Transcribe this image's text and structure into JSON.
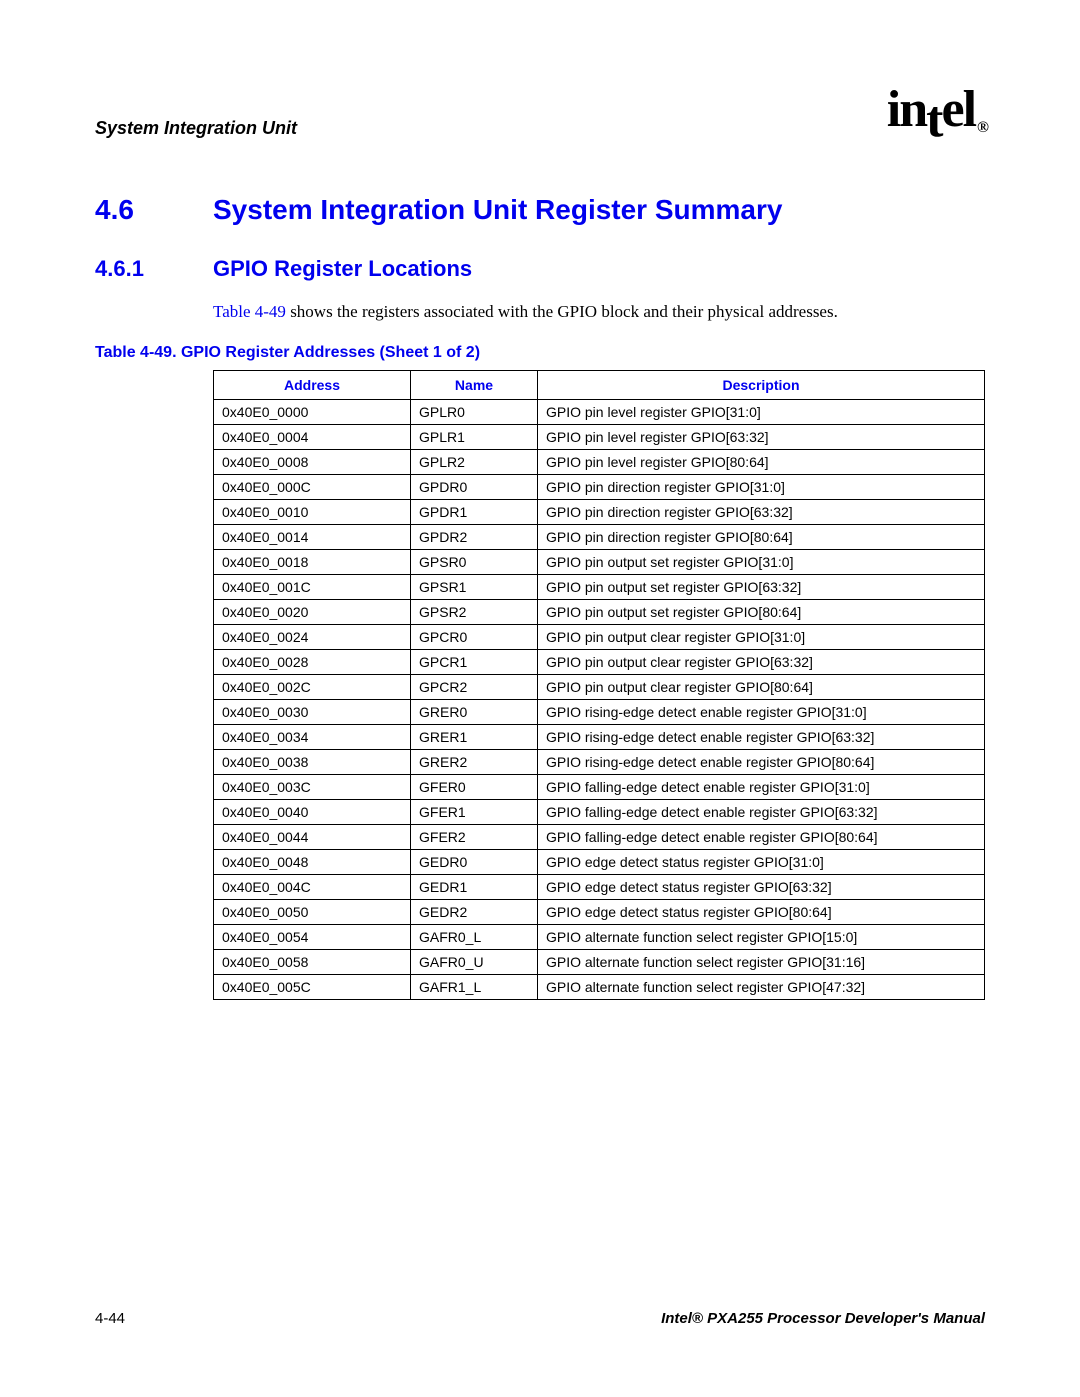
{
  "header": {
    "chapter_title": "System Integration Unit",
    "logo_text": "intel",
    "logo_reg": "®"
  },
  "section": {
    "num": "4.6",
    "title": "System Integration Unit Register Summary"
  },
  "subsection": {
    "num": "4.6.1",
    "title": "GPIO Register Locations"
  },
  "body": {
    "link_text": "Table 4-49",
    "rest_text": " shows the registers associated with the GPIO block and their physical addresses."
  },
  "table": {
    "caption": "Table 4-49. GPIO Register Addresses (Sheet 1 of 2)",
    "headers": {
      "address": "Address",
      "name": "Name",
      "description": "Description"
    },
    "rows": [
      {
        "address": "0x40E0_0000",
        "name": "GPLR0",
        "description": "GPIO pin level register GPIO[31:0]"
      },
      {
        "address": "0x40E0_0004",
        "name": "GPLR1",
        "description": "GPIO pin level register GPIO[63:32]"
      },
      {
        "address": "0x40E0_0008",
        "name": "GPLR2",
        "description": "GPIO pin level register GPIO[80:64]"
      },
      {
        "address": "0x40E0_000C",
        "name": "GPDR0",
        "description": "GPIO pin direction register GPIO[31:0]"
      },
      {
        "address": "0x40E0_0010",
        "name": "GPDR1",
        "description": "GPIO pin direction register GPIO[63:32]"
      },
      {
        "address": "0x40E0_0014",
        "name": "GPDR2",
        "description": "GPIO pin direction register GPIO[80:64]"
      },
      {
        "address": "0x40E0_0018",
        "name": "GPSR0",
        "description": "GPIO pin output set register GPIO[31:0]"
      },
      {
        "address": "0x40E0_001C",
        "name": "GPSR1",
        "description": "GPIO pin output set register GPIO[63:32]"
      },
      {
        "address": "0x40E0_0020",
        "name": "GPSR2",
        "description": "GPIO pin output set register GPIO[80:64]"
      },
      {
        "address": "0x40E0_0024",
        "name": "GPCR0",
        "description": "GPIO pin output clear register GPIO[31:0]"
      },
      {
        "address": "0x40E0_0028",
        "name": "GPCR1",
        "description": "GPIO pin output clear register GPIO[63:32]"
      },
      {
        "address": "0x40E0_002C",
        "name": "GPCR2",
        "description": "GPIO pin output clear register GPIO[80:64]"
      },
      {
        "address": "0x40E0_0030",
        "name": "GRER0",
        "description": "GPIO rising-edge detect enable register GPIO[31:0]"
      },
      {
        "address": "0x40E0_0034",
        "name": "GRER1",
        "description": "GPIO rising-edge detect enable register GPIO[63:32]"
      },
      {
        "address": "0x40E0_0038",
        "name": "GRER2",
        "description": "GPIO rising-edge detect enable register GPIO[80:64]"
      },
      {
        "address": "0x40E0_003C",
        "name": "GFER0",
        "description": "GPIO falling-edge detect enable register GPIO[31:0]"
      },
      {
        "address": "0x40E0_0040",
        "name": "GFER1",
        "description": "GPIO falling-edge detect enable register GPIO[63:32]"
      },
      {
        "address": "0x40E0_0044",
        "name": "GFER2",
        "description": "GPIO falling-edge detect enable register GPIO[80:64]"
      },
      {
        "address": "0x40E0_0048",
        "name": "GEDR0",
        "description": "GPIO edge detect status register GPIO[31:0]"
      },
      {
        "address": "0x40E0_004C",
        "name": "GEDR1",
        "description": "GPIO edge detect status register GPIO[63:32]"
      },
      {
        "address": "0x40E0_0050",
        "name": "GEDR2",
        "description": "GPIO edge detect status register GPIO[80:64]"
      },
      {
        "address": "0x40E0_0054",
        "name": "GAFR0_L",
        "description": "GPIO alternate function select register GPIO[15:0]"
      },
      {
        "address": "0x40E0_0058",
        "name": "GAFR0_U",
        "description": "GPIO alternate function select register GPIO[31:16]"
      },
      {
        "address": "0x40E0_005C",
        "name": "GAFR1_L",
        "description": "GPIO alternate function select register GPIO[47:32]"
      }
    ]
  },
  "footer": {
    "left": "4-44",
    "right": "Intel® PXA255 Processor Developer's Manual"
  }
}
